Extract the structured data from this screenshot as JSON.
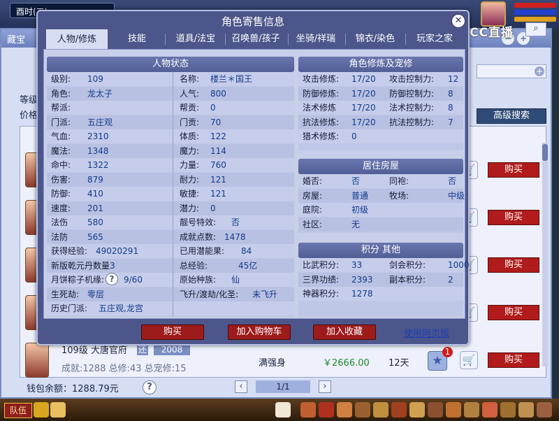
{
  "background": {
    "clock_text": "酉时(三)",
    "window_title": "藏宝",
    "labels": [
      "等级",
      "价格"
    ],
    "advanced_search": "高级搜索",
    "search_icon": "search-icon",
    "rows": [
      {
        "buy": "购买",
        "cart_icon": "cart-icon"
      },
      {
        "buy": "购买",
        "cart_icon": "cart-icon"
      },
      {
        "buy": "购买",
        "cart_icon": "cart-icon"
      },
      {
        "buy": "购买",
        "cart_icon": "cart-icon"
      }
    ],
    "last_row": {
      "level_school": "109级  大唐官府",
      "tag": "还",
      "year": "2008",
      "stats": "成就:1288 总修:43 总宠修:15",
      "physique": "满强身",
      "price": "￥2666.00",
      "days": "12天",
      "star_badge": "1",
      "buy": "购买"
    },
    "wallet_label": "钱包余额：1288.79元",
    "pager": "1/1",
    "team_button": "队伍",
    "cc_logo": "CC直播"
  },
  "dialog": {
    "title": "角色寄售信息",
    "close": "✕",
    "tabs": [
      "人物/修炼",
      "技能",
      "道具/法宝",
      "召唤兽/孩子",
      "坐骑/祥瑞",
      "锦衣/染色",
      "玩家之家"
    ],
    "status": {
      "header": "人物状态",
      "left": [
        {
          "k": "级别:",
          "v": "109"
        },
        {
          "k": "角色:",
          "v": "龙太子"
        },
        {
          "k": "帮派:",
          "v": ""
        },
        {
          "k": "门派:",
          "v": "五庄观"
        },
        {
          "k": "气血:",
          "v": "2310"
        },
        {
          "k": "魔法:",
          "v": "1348"
        },
        {
          "k": "命中:",
          "v": "1322"
        },
        {
          "k": "伤害:",
          "v": "879"
        },
        {
          "k": "防御:",
          "v": "410"
        },
        {
          "k": "速度:",
          "v": "201"
        },
        {
          "k": "法伤",
          "v": "580"
        },
        {
          "k": "法防",
          "v": "565"
        },
        {
          "k": "获得经验:",
          "v": "49020291"
        },
        {
          "k": "新版乾元丹数量",
          "v": "3"
        },
        {
          "k": "月饼粽子机缘:",
          "v": "9/60"
        },
        {
          "k": "生死劫:",
          "v": "零层"
        },
        {
          "k": "历史门派:",
          "v": "五庄观,龙宫"
        }
      ],
      "right": [
        {
          "k": "名称:",
          "v": "楼兰＊国王"
        },
        {
          "k": "人气:",
          "v": "800"
        },
        {
          "k": "帮贡:",
          "v": "0"
        },
        {
          "k": "门贡:",
          "v": "70"
        },
        {
          "k": "体质:",
          "v": "122"
        },
        {
          "k": "魔力:",
          "v": "114"
        },
        {
          "k": "力量:",
          "v": "760"
        },
        {
          "k": "耐力:",
          "v": "121"
        },
        {
          "k": "敏捷:",
          "v": "121"
        },
        {
          "k": "潜力:",
          "v": "0"
        },
        {
          "k": "靓号特效:",
          "v": "否"
        },
        {
          "k": "成就点数:",
          "v": "1478"
        },
        {
          "k": "已用潜能果:",
          "v": "84"
        },
        {
          "k": "总经验:",
          "v": "45亿"
        },
        {
          "k": "原始种族:",
          "v": "仙"
        },
        {
          "k": "飞升/渡劫/化圣:",
          "v": "未飞升"
        }
      ]
    },
    "cultivation": {
      "header": "角色修炼及宠修",
      "rows": [
        {
          "k1": "攻击修炼:",
          "v1": "17/20",
          "k2": "攻击控制力:",
          "v2": "12"
        },
        {
          "k1": "防御修炼:",
          "v1": "17/20",
          "k2": "防御控制力:",
          "v2": "8"
        },
        {
          "k1": "法术修炼",
          "v1": "17/20",
          "k2": "法术控制力:",
          "v2": "8"
        },
        {
          "k1": "抗法修炼:",
          "v1": "17/20",
          "k2": "抗法控制力:",
          "v2": "7"
        },
        {
          "k1": "猎术修炼:",
          "v1": "0",
          "k2": "",
          "v2": ""
        }
      ]
    },
    "house": {
      "header": "居住房屋",
      "rows": [
        {
          "k1": "婚否:",
          "v1": "否",
          "k2": "同袍:",
          "v2": "否"
        },
        {
          "k1": "房屋:",
          "v1": "普通",
          "k2": "牧场:",
          "v2": "中级"
        },
        {
          "k1": "庭院:",
          "v1": "初级",
          "k2": "",
          "v2": ""
        },
        {
          "k1": "社区:",
          "v1": "无",
          "k2": "",
          "v2": ""
        }
      ]
    },
    "points": {
      "header": "积分 其他",
      "rows": [
        {
          "k1": "比武积分:",
          "v1": "33",
          "k2": "剑会积分:",
          "v2": "1000"
        },
        {
          "k1": "三界功绩:",
          "v1": "2393",
          "k2": "副本积分:",
          "v2": "2"
        },
        {
          "k1": "神器积分:",
          "v1": "1278",
          "k2": "",
          "v2": ""
        }
      ]
    },
    "buttons": {
      "buy": "购买",
      "add_cart": "加入购物车",
      "add_fav": "加入收藏",
      "web": "使用网页版"
    }
  }
}
